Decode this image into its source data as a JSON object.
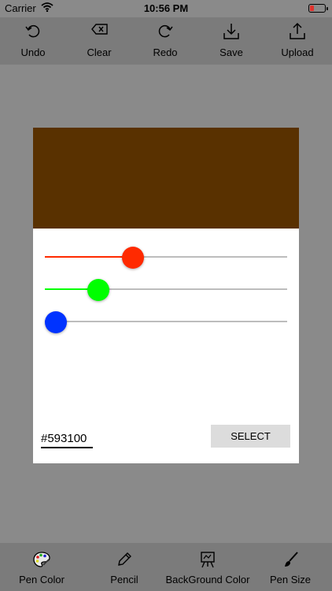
{
  "status": {
    "carrier": "Carrier",
    "time": "10:56 PM"
  },
  "toolbar": {
    "undo": "Undo",
    "clear": "Clear",
    "redo": "Redo",
    "save": "Save",
    "upload": "Upload"
  },
  "color_picker": {
    "preview_color": "#593100",
    "red": {
      "value": 89,
      "max": 255,
      "color": "#ff2a00"
    },
    "green": {
      "value": 49,
      "max": 255,
      "color": "#00ff00"
    },
    "blue": {
      "value": 0,
      "max": 255,
      "color": "#0033ff"
    },
    "hex_value": "#593100",
    "select_label": "SELECT"
  },
  "bottombar": {
    "pen_color": "Pen Color",
    "pencil": "Pencil",
    "background_color": "BackGround Color",
    "pen_size": "Pen Size"
  }
}
